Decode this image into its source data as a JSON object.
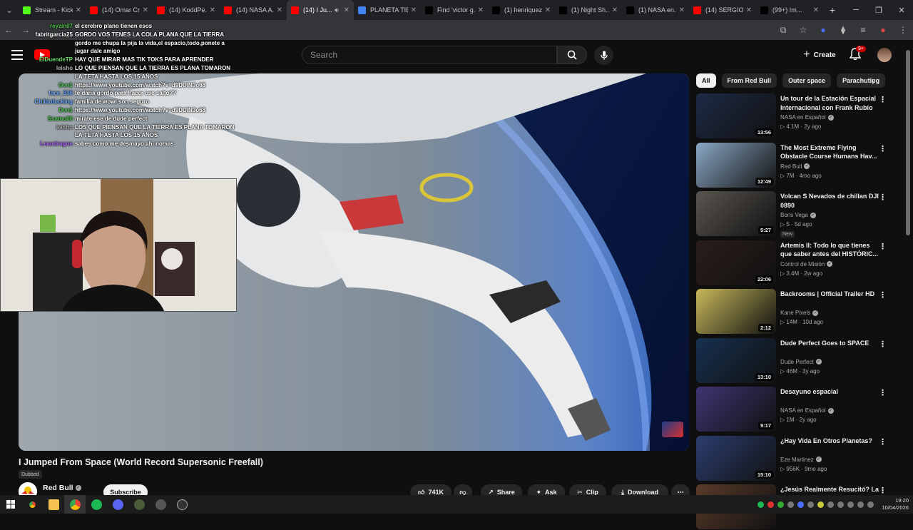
{
  "browser": {
    "tabs": [
      {
        "label": "Stream - Kick",
        "favicon": "kick-icon",
        "color": "#53fc18",
        "active": false
      },
      {
        "label": "(14) Omar Cr...",
        "favicon": "youtube-icon",
        "color": "#ff0000",
        "active": false
      },
      {
        "label": "(14) KoddPe...",
        "favicon": "youtube-icon",
        "color": "#ff0000",
        "active": false
      },
      {
        "label": "(14) NASA A...",
        "favicon": "youtube-icon",
        "color": "#ff0000",
        "active": false
      },
      {
        "label": "(14) I Ju...",
        "favicon": "youtube-icon",
        "color": "#ff0000",
        "active": true
      },
      {
        "label": "PLANETA TIE...",
        "favicon": "chrome-icon",
        "color": "#4285f4",
        "active": false
      },
      {
        "label": "Find 'victor g...",
        "favicon": "tiktok-icon",
        "color": "#000000",
        "active": false
      },
      {
        "label": "(1) henriquez...",
        "favicon": "x-icon",
        "color": "#000000",
        "active": false
      },
      {
        "label": "(1) Night Sh...",
        "favicon": "x-icon",
        "color": "#000000",
        "active": false
      },
      {
        "label": "(1) NASA en...",
        "favicon": "x-icon",
        "color": "#000000",
        "active": false
      },
      {
        "label": "(14) SERGIO...",
        "favicon": "youtube-icon",
        "color": "#ff0000",
        "active": false
      },
      {
        "label": "(99+) Im...",
        "favicon": "tiktok-icon",
        "color": "#000000",
        "active": false
      }
    ]
  },
  "youtube": {
    "search_placeholder": "Search",
    "create_label": "Create",
    "notifications_badge": "9+",
    "video": {
      "title": "I Jumped From Space (World Record Supersonic Freefall)",
      "dubbed": "Dubbed",
      "channel": "Red Bull",
      "subscribe": "Subscribe",
      "likes": "741K",
      "share": "Share",
      "ask": "Ask",
      "clip": "Clip",
      "download": "Download"
    },
    "chips": [
      "All",
      "From Red Bull",
      "Outer space",
      "Parachuting"
    ],
    "recommendations": [
      {
        "title": "Un tour de la Estación Espacial Internacional con Frank Rubio",
        "channel": "NASA en Español",
        "meta": "4.1M · 2y ago",
        "duration": "13:56",
        "thumb": "#1c2a44"
      },
      {
        "title": "The Most Extreme Flying Obstacle Course Humans Hav...",
        "channel": "Red Bull",
        "meta": "7M · 4mo ago",
        "duration": "12:49",
        "thumb": "#8aa7c4"
      },
      {
        "title": "Volcan  S Nevados de chillan DJI 0890",
        "channel": "Boris Vega",
        "meta": "5 · 5d ago",
        "duration": "5:27",
        "thumb": "#5a5550",
        "badge": "New"
      },
      {
        "title": "Artemis II: Todo lo que tienes que saber antes del HISTÓRIC...",
        "channel": "Control de Misión",
        "meta": "3.4M · 2w ago",
        "duration": "22:06",
        "thumb": "#2a1d1a"
      },
      {
        "title": "Backrooms | Official Trailer HD",
        "channel": "Kane Pixels",
        "meta": "14M · 10d ago",
        "duration": "2:12",
        "thumb": "#c7b85a"
      },
      {
        "title": "Dude Perfect Goes to SPACE",
        "channel": "Dude Perfect",
        "meta": "46M · 3y ago",
        "duration": "13:10",
        "thumb": "#16304f"
      },
      {
        "title": "Desayuno espacial",
        "channel": "NASA en Español",
        "meta": "1M · 2y ago",
        "duration": "9:17",
        "thumb": "#3f3472"
      },
      {
        "title": "¿Hay Vida En Otros Planetas?",
        "channel": "Eze Martinez",
        "meta": "956K · 9mo ago",
        "duration": "15:10",
        "thumb": "#2c3e6e"
      },
      {
        "title": "¿Jesús Realmente Resucitó? La",
        "channel": "",
        "meta": "",
        "duration": "",
        "thumb": "#5a3b2a"
      }
    ]
  },
  "chat": [
    {
      "user": "reyzin07",
      "color": "#4cc94c",
      "text": "el cerebro plano tienen esos"
    },
    {
      "user": "fabritgarcia25",
      "color": "#ffffff",
      "text": "GORDO VOS TENES LA COLA PLANA QUE LA TIERRA"
    },
    {
      "user": "",
      "color": "#ffffff",
      "text": "gordo me chupa la pija la vida,el espacio,todo,ponete a jugar dale amigo"
    },
    {
      "user": "ElDuendeTP",
      "color": "#6fe36f",
      "text": "HAY QUE MIRAR MAS TIK TOKS PARA APRENDER"
    },
    {
      "user": "leisho",
      "color": "#b0b0b0",
      "text": "LO QUE PIENSAN QUE LA TIERRA ES PLANA TOMARON LA TETA HASTA LOS 15 AÑOS"
    },
    {
      "user": "Ovn1",
      "color": "#4cc94c",
      "text": "https://www.youtube.com/watch?v=d9DUIN3o68"
    },
    {
      "user": "face_836",
      "color": "#6aa7ff",
      "text": "te daria gordo para hacer ese salto??"
    },
    {
      "user": "Chilitofucking",
      "color": "#6aa7ff",
      "text": "familia de wowi son seguro"
    },
    {
      "user": "Ovn1",
      "color": "#4cc94c",
      "text": "https://www.youtube.com/watch?v=d9DUIN3o68"
    },
    {
      "user": "Ssamu00",
      "color": "#4cc94c",
      "text": "mirate ese de dude perfect"
    },
    {
      "user": "leisho",
      "color": "#b0b0b0",
      "text": "LOS QUE PIENSAN QUE LA TIERRA ES PLANA TOMARON LA TETA HASTA LOS 15 AÑOS"
    },
    {
      "user": "Leandragon",
      "color": "#b36bff",
      "text": "sabes como me desmayo ahi nomas"
    }
  ],
  "taskbar": {
    "time": "19:20",
    "date": "10/04/2026"
  }
}
